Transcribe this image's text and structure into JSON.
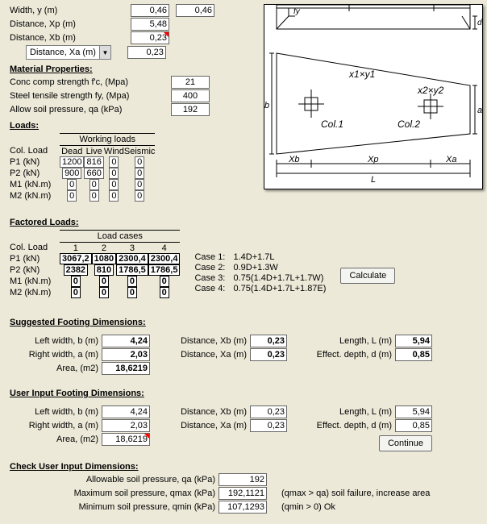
{
  "top": {
    "width_label": "Width, y (m)",
    "width_val1": "0,46",
    "width_val2": "0,46",
    "dist_xp_label": "Distance, Xp (m)",
    "dist_xp_val": "5,48",
    "dist_xb_label": "Distance, Xb (m)",
    "dist_xb_val": "0,23",
    "dist_xa_label": "Distance, Xa (m)",
    "dist_xa_val": "0,23"
  },
  "mat": {
    "heading": "Material Properties:",
    "fc_label": "Conc comp strength f'c, (Mpa)",
    "fc_val": "21",
    "fy_label": "Steel tensile strength fy, (Mpa)",
    "fy_val": "400",
    "qa_label": "Allow soil pressure, qa (kPa)",
    "qa_val": "192"
  },
  "loads": {
    "heading": "Loads:",
    "header_group": "Working loads",
    "col_load": "Col. Load",
    "col1": "Dead",
    "col2": "Live",
    "col3": "Wind",
    "col4": "Seismic",
    "rows": [
      {
        "lbl": "P1 (kN)",
        "v": [
          "1200",
          "816",
          "0",
          "0"
        ]
      },
      {
        "lbl": "P2 (kN)",
        "v": [
          "900",
          "660",
          "0",
          "0"
        ]
      },
      {
        "lbl": "M1 (kN.m)",
        "v": [
          "0",
          "0",
          "0",
          "0"
        ]
      },
      {
        "lbl": "M2 (kN.m)",
        "v": [
          "0",
          "0",
          "0",
          "0"
        ]
      }
    ]
  },
  "factored": {
    "heading": "Factored Loads:",
    "header_group": "Load cases",
    "col_load": "Col. Load",
    "cols": [
      "1",
      "2",
      "3",
      "4"
    ],
    "rows": [
      {
        "lbl": "P1 (kN)",
        "v": [
          "3067,2",
          "1080",
          "2300,4",
          "2300,4"
        ]
      },
      {
        "lbl": "P2 (kN)",
        "v": [
          "2382",
          "810",
          "1786,5",
          "1786,5"
        ]
      },
      {
        "lbl": "M1 (kN.m)",
        "v": [
          "0",
          "0",
          "0",
          "0"
        ]
      },
      {
        "lbl": "M2 (kN.m)",
        "v": [
          "0",
          "0",
          "0",
          "0"
        ]
      }
    ],
    "cases": [
      {
        "lbl": "Case 1:",
        "txt": "1.4D+1.7L"
      },
      {
        "lbl": "Case 2:",
        "txt": "0.9D+1.3W"
      },
      {
        "lbl": "Case 3:",
        "txt": "0.75(1.4D+1.7L+1.7W)"
      },
      {
        "lbl": "Case 4:",
        "txt": "0.75(1.4D+1.7L+1.87E)"
      }
    ],
    "calc_btn": "Calculate"
  },
  "suggested": {
    "heading": "Suggested Footing Dimensions:",
    "b_label": "Left width, b (m)",
    "b_val": "4,24",
    "a_label": "Right width, a (m)",
    "a_val": "2,03",
    "area_label": "Area, (m2)",
    "area_val": "18,6219",
    "xb_label": "Distance, Xb (m)",
    "xb_val": "0,23",
    "xa_label": "Distance, Xa (m)",
    "xa_val": "0,23",
    "L_label": "Length, L (m)",
    "L_val": "5,94",
    "d_label": "Effect. depth, d (m)",
    "d_val": "0,85"
  },
  "userinput": {
    "heading": "User Input Footing Dimensions:",
    "b_label": "Left width, b (m)",
    "b_val": "4,24",
    "a_label": "Right width, a (m)",
    "a_val": "2,03",
    "area_label": "Area, (m2)",
    "area_val": "18,6219",
    "xb_label": "Distance, Xb (m)",
    "xb_val": "0,23",
    "xa_label": "Distance, Xa (m)",
    "xa_val": "0,23",
    "L_label": "Length, L (m)",
    "L_val": "5,94",
    "d_label": "Effect. depth, d (m)",
    "d_val": "0,85",
    "continue_btn": "Continue"
  },
  "check": {
    "heading": "Check User Input Dimensions:",
    "qa_label": "Allowable soil pressure, qa (kPa)",
    "qa_val": "192",
    "qmax_label": "Maximum soil pressure, qmax (kPa)",
    "qmax_val": "192,1121",
    "qmax_note": "(qmax > qa) soil failure, increase area",
    "qmin_label": "Minimum soil pressure, qmin (kPa)",
    "qmin_val": "107,1293",
    "qmin_note": "(qmin > 0) Ok"
  },
  "diagram": {
    "fy": "fy",
    "d": "d",
    "x1y1": "x1×y1",
    "x2y2": "x2×y2",
    "col1": "Col.1",
    "col2": "Col.2",
    "b": "b",
    "a": "a",
    "Xb": "Xb",
    "Xp": "Xp",
    "Xa": "Xa",
    "L": "L"
  }
}
